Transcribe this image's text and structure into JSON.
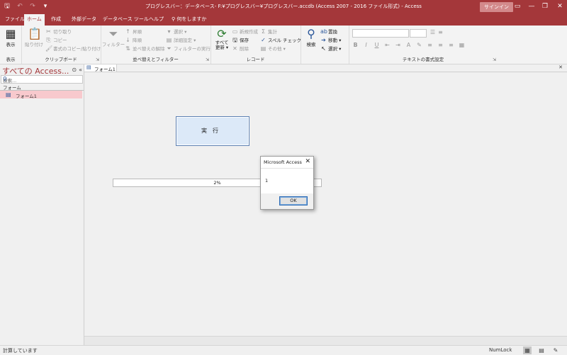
{
  "titlebar": {
    "title": "プログレスバー：データベース- F:¥プログレスバー¥プログレスバー.accdb (Access 2007 - 2016 ファイル形式)  -  Access",
    "signin": "サインイン",
    "qat": {
      "save": "🖫",
      "undo": "↶",
      "redo": "↷",
      "customize": "▾"
    },
    "winbtns": {
      "options": "▭",
      "minimize": "—",
      "restore": "❐",
      "close": "✕"
    }
  },
  "tabs": [
    "ファイル",
    "ホーム",
    "作成",
    "外部データ",
    "データベース ツール",
    "ヘルプ"
  ],
  "tellme": "何をしますか",
  "ribbon": {
    "groups": {
      "view": "表示",
      "clipboard": "クリップボード",
      "sortfilter": "並べ替えとフィルター",
      "records": "レコード",
      "find": "検索",
      "textformat": "テキストの書式設定"
    },
    "view_btn": "表示",
    "paste": "貼り付け",
    "cut": "切り取り",
    "copy": "コピー",
    "formatpainter": "書式のコピー/貼り付け",
    "filter": "フィルター",
    "ascending": "昇順",
    "descending": "降順",
    "removesort": "並べ替えの解除",
    "selection": "選択 ▾",
    "advanced": "詳細設定 ▾",
    "togglefilter": "フィルターの実行",
    "refresh": "すべて\n更新 ▾",
    "newrec": "新規作成",
    "saverec": "保存",
    "deleterec": "削除",
    "totals": "集計",
    "spelling": "スペル チェック",
    "more": "その他 ▾",
    "search": "検索",
    "replace": "置換",
    "goto": "移動 ▾",
    "select": "選択 ▾"
  },
  "nav": {
    "title": "すべての Access...",
    "search_placeholder": "検索...",
    "section": "フォーム",
    "items": [
      "フォーム1"
    ]
  },
  "document": {
    "tab": "フォーム1",
    "run_button": "実行",
    "progress_text": "2%",
    "progress_value": 0.02
  },
  "dialog": {
    "title": "Microsoft Access",
    "message": "1",
    "ok": "OK"
  },
  "status": {
    "text": "計算しています",
    "numlock": "NumLock"
  }
}
